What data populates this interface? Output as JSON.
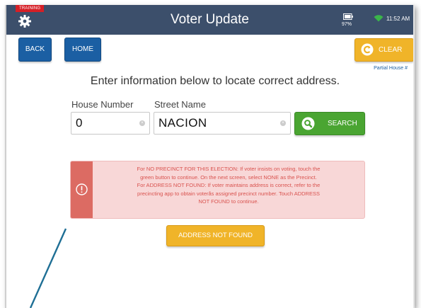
{
  "status_bar": {
    "training_badge": "TRAINING",
    "title": "Voter Update",
    "battery_percent": "97%",
    "time": "11:52 AM",
    "color": "#3c4f6b"
  },
  "nav": {
    "back_label": "BACK",
    "home_label": "HOME",
    "clear_label": "CLEAR"
  },
  "partial_house_link": "Partial House #",
  "instruction": "Enter information below to locate correct address.",
  "form": {
    "house_number_label": "House Number",
    "house_number_value": "0",
    "street_name_label": "Street Name",
    "street_name_value": "NACION",
    "search_label": "SEARCH"
  },
  "alert": {
    "line1": "For NO PRECINCT FOR THIS ELECTION: If voter insists on voting, touch the",
    "line2": "green button to continue. On the next screen, select NONE as the Precinct.",
    "line3": "For ADDRESS NOT FOUND: If voter maintains address is correct, refer to the",
    "line4": "precincting app to obtain voterås assigned precinct number. Touch ADDRESS",
    "line5": "NOT FOUND to continue."
  },
  "address_not_found_label": "ADDRESS NOT FOUND",
  "icons": [
    "gear-icon",
    "battery-icon",
    "wifi-icon",
    "clear-icon",
    "search-icon",
    "alert-icon"
  ],
  "colors": {
    "blue_button": "#1b5fa3",
    "yellow_button": "#f0b429",
    "green_button": "#4aa532",
    "alert_bg": "#f8d7d7",
    "alert_text": "#d9534f"
  }
}
